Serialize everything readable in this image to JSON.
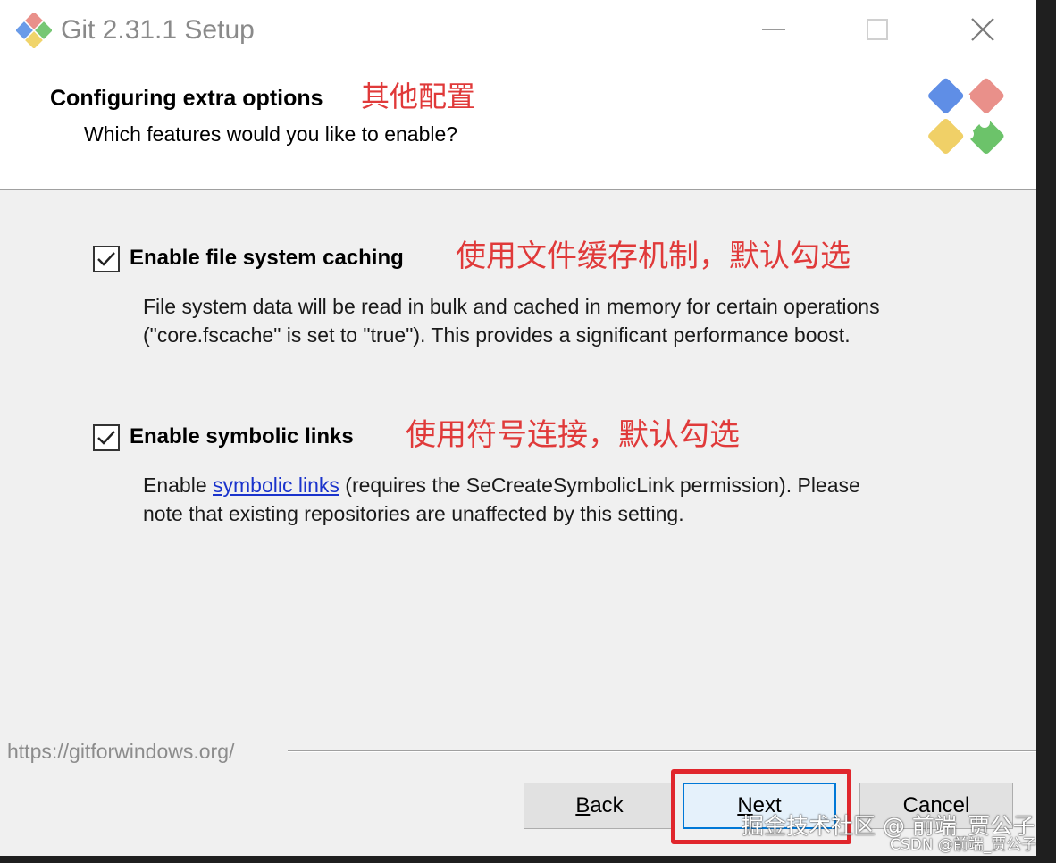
{
  "window": {
    "title": "Git 2.31.1 Setup",
    "controls": [
      "minimize",
      "maximize",
      "close"
    ]
  },
  "header": {
    "title": "Configuring extra options",
    "annotation": "其他配置",
    "subtitle": "Which features would you like to enable?"
  },
  "options": [
    {
      "label": "Enable file system caching",
      "checked": true,
      "annotation": "使用文件缓存机制，默认勾选",
      "description": "File system data will be read in bulk and cached in memory for certain operations (\"core.fscache\" is set to \"true\"). This provides a significant performance boost."
    },
    {
      "label": "Enable symbolic links",
      "checked": true,
      "annotation": "使用符号连接，默认勾选",
      "description_prefix": "Enable ",
      "description_link": "symbolic links",
      "description_suffix": " (requires the SeCreateSymbolicLink permission). Please note that existing repositories are unaffected by this setting."
    }
  ],
  "footer": {
    "url": "https://gitforwindows.org/",
    "back_label": "Back",
    "next_label": "Next",
    "cancel_label": "Cancel"
  },
  "watermark": {
    "line1": "掘金技术社区 @ 前端_贾公子",
    "line2": "CSDN @前端_贾公子"
  },
  "colors": {
    "annotation": "#e03a3a",
    "highlight": "#e0262c",
    "link": "#1a33cc",
    "focus": "#0078d7"
  }
}
